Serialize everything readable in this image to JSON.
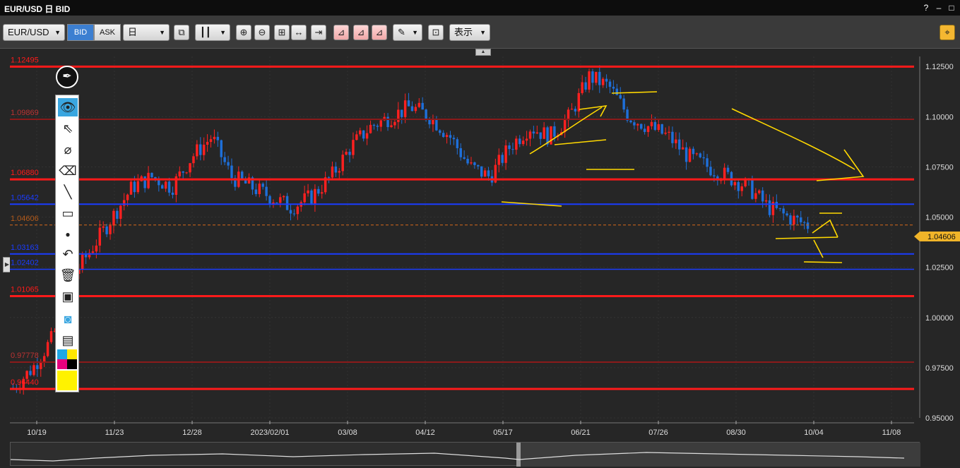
{
  "window": {
    "title": "EUR/USD 日 BID",
    "help": "?",
    "minimize": "–",
    "maximize": "□",
    "close": "✕"
  },
  "toolbar": {
    "symbol": "EUR/USD",
    "bid": "BID",
    "ask": "ASK",
    "period": "日",
    "display": "表示"
  },
  "price_axis": [
    "1.12500",
    "1.10000",
    "1.07500",
    "1.05000",
    "1.02500",
    "1.00000",
    "0.97500",
    "0.95000"
  ],
  "current_price": "1.04606",
  "time_axis": [
    "10/19",
    "11/23",
    "12/28",
    "2023/02/01",
    "03/08",
    "04/12",
    "05/17",
    "06/21",
    "07/26",
    "08/30",
    "10/04",
    "11/08"
  ],
  "h_lines": [
    {
      "label": "1.12495",
      "color": "#ff1a1a",
      "price": 1.12495,
      "width": 3
    },
    {
      "label": "1.09869",
      "color": "#8b1a1a",
      "price": 1.09869,
      "width": 2
    },
    {
      "label": "1.06880",
      "color": "#ff1a1a",
      "price": 1.0688,
      "width": 3
    },
    {
      "label": "1.05642",
      "color": "#1a3cff",
      "price": 1.05642,
      "width": 2
    },
    {
      "label": "1.04606",
      "color": "#b35a1a",
      "price": 1.04606,
      "width": 1
    },
    {
      "label": "1.03163",
      "color": "#1a3cff",
      "price": 1.03163,
      "width": 2
    },
    {
      "label": "1.02402",
      "color": "#1a3cff",
      "price": 1.02402,
      "width": 1.5
    },
    {
      "label": "1.01065",
      "color": "#ff1a1a",
      "price": 1.01065,
      "width": 3
    },
    {
      "label": "0.97778",
      "color": "#8b1a1a",
      "price": 0.97778,
      "width": 2
    },
    {
      "label": "0.96440",
      "color": "#ff1a1a",
      "price": 0.9644,
      "width": 3
    }
  ],
  "chart_data": {
    "type": "candlestick",
    "series": "EUR/USD daily BID",
    "ylim": [
      0.95,
      1.13
    ],
    "x": [
      "10/19",
      "11/23",
      "12/28",
      "2023/02/01",
      "03/08",
      "04/12",
      "05/17",
      "06/21",
      "07/26",
      "08/30",
      "10/04",
      "11/08"
    ],
    "close_path": [
      0.965,
      0.975,
      0.99,
      1.02,
      1.035,
      1.05,
      1.065,
      1.07,
      1.065,
      1.08,
      1.09,
      1.07,
      1.065,
      1.06,
      1.055,
      1.06,
      1.07,
      1.085,
      1.095,
      1.1,
      1.105,
      1.1,
      1.09,
      1.075,
      1.07,
      1.085,
      1.095,
      1.09,
      1.1,
      1.12,
      1.115,
      1.1,
      1.095,
      1.09,
      1.08,
      1.075,
      1.07,
      1.065,
      1.055,
      1.05,
      1.046
    ],
    "colors": {
      "up": "#ff2020",
      "down": "#1e6fd9"
    }
  }
}
